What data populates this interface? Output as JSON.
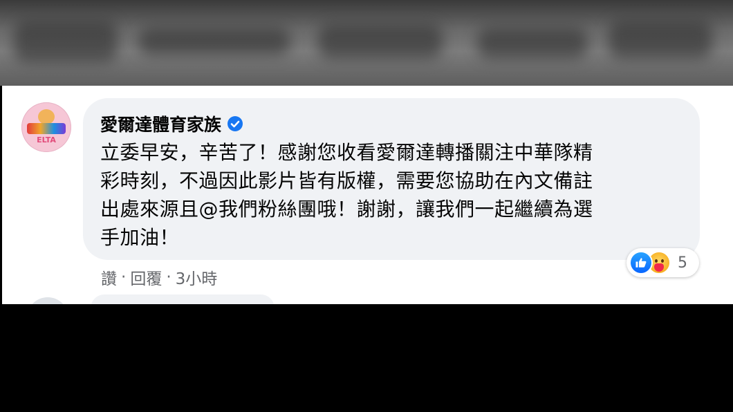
{
  "comment": {
    "author": "愛爾達體育家族",
    "avatar_text": "ELTA",
    "lines": [
      "立委早安，辛苦了！感謝您收看愛爾達轉播關注中華隊精",
      "彩時刻，不過因此影片皆有版權，需要您協助在內文備註",
      "出處來源且@我們粉絲團哦！謝謝，讓我們一起繼續為選",
      "手加油！"
    ],
    "reaction_count": "5",
    "actions": {
      "like": "讚",
      "separator": "·",
      "reply": "回覆",
      "time": "3小時"
    }
  },
  "colors": {
    "bubble_bg": "#f0f2f5",
    "verified_blue": "#1877f2",
    "meta_gray": "#65676b"
  }
}
